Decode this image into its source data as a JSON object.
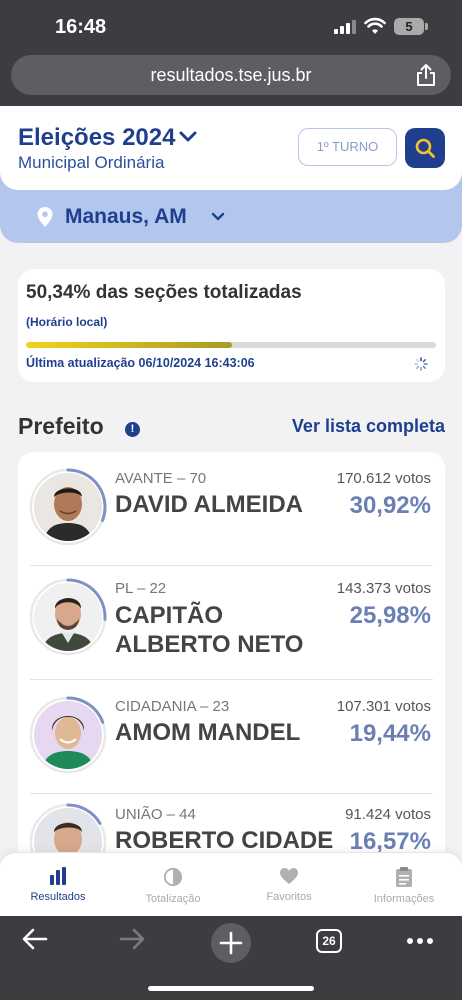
{
  "status_bar": {
    "time": "16:48",
    "battery": "5"
  },
  "browser": {
    "url": "resultados.tse.jus.br",
    "tabs_count": "26"
  },
  "header": {
    "title": "Eleições 2024",
    "subtitle": "Municipal Ordinária",
    "turno_label": "1º TURNO",
    "brand_color": "#1f3f8e"
  },
  "location": {
    "city": "Manaus, AM"
  },
  "progress": {
    "title": "50,34% das seções totalizadas",
    "timezone_note": "(Horário local)",
    "percent": 50.34,
    "last_update": "Última atualização 06/10/2024 16:43:06"
  },
  "section": {
    "title": "Prefeito",
    "see_all": "Ver lista completa"
  },
  "candidates": [
    {
      "party": "AVANTE – 70",
      "name": "DAVID ALMEIDA",
      "votes": "170.612 votos",
      "percent": "30,92%",
      "share": 30.92
    },
    {
      "party": "PL – 22",
      "name": "CAPITÃO ALBERTO NETO",
      "votes": "143.373 votos",
      "percent": "25,98%",
      "share": 25.98
    },
    {
      "party": "CIDADANIA – 23",
      "name": "AMOM MANDEL",
      "votes": "107.301 votos",
      "percent": "19,44%",
      "share": 19.44
    },
    {
      "party": "UNIÃO – 44",
      "name": "ROBERTO CIDADE",
      "votes": "91.424 votos",
      "percent": "16,57%",
      "share": 16.57
    }
  ],
  "tab_bar": {
    "items": [
      {
        "label": "Resultados",
        "icon": "bar-chart-icon",
        "active": true
      },
      {
        "label": "Totalização",
        "icon": "pie-chart-icon",
        "active": false
      },
      {
        "label": "Favoritos",
        "icon": "heart-icon",
        "active": false
      },
      {
        "label": "Informações",
        "icon": "clipboard-icon",
        "active": false
      }
    ]
  }
}
